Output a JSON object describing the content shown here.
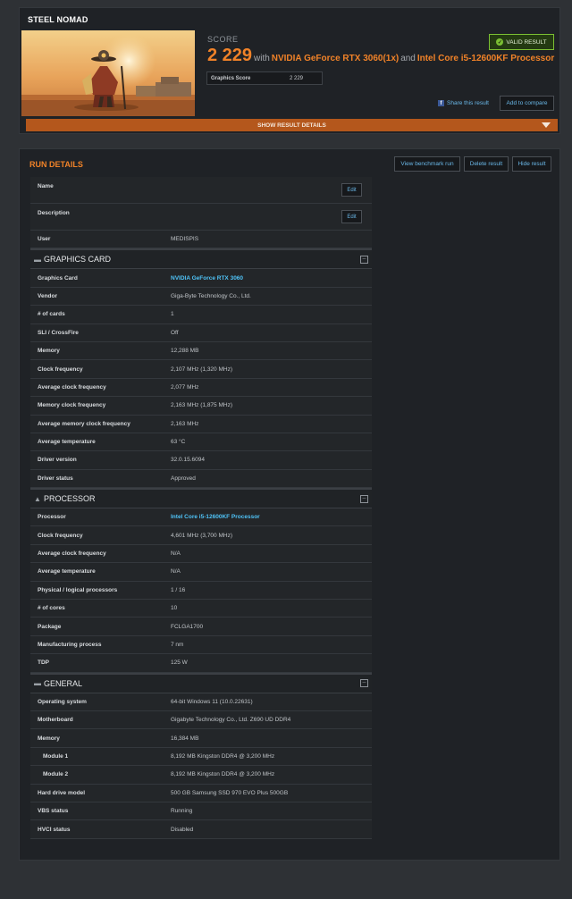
{
  "top": {
    "title": "STEEL NOMAD",
    "score_label": "SCORE",
    "score_value": "2 229",
    "with_text": "with",
    "gpu_text": "NVIDIA GeForce RTX 3060(1x)",
    "and_text": "and",
    "cpu_text": "Intel Core i5-12600KF Processor",
    "graphics_score_label": "Graphics Score",
    "graphics_score_value": "2 229",
    "valid_label": "VALID RESULT",
    "share_label": "Share this result",
    "compare_label": "Add to compare",
    "show_details_label": "SHOW RESULT DETAILS"
  },
  "run": {
    "title": "RUN DETAILS",
    "buttons": {
      "view": "View benchmark run",
      "delete": "Delete result",
      "hide": "Hide result"
    },
    "edit_label": "Edit",
    "name_label": "Name",
    "description_label": "Description",
    "user_label": "User",
    "user_value": "MEDISPIS"
  },
  "graphics": {
    "title": "GRAPHICS CARD",
    "rows": [
      {
        "label": "Graphics Card",
        "value": "NVIDIA GeForce RTX 3060"
      },
      {
        "label": "Vendor",
        "value": "Giga-Byte Technology Co., Ltd."
      },
      {
        "label": "# of cards",
        "value": "1"
      },
      {
        "label": "SLI / CrossFire",
        "value": "Off"
      },
      {
        "label": "Memory",
        "value": "12,288 MB"
      },
      {
        "label": "Clock frequency",
        "value": "2,107 MHz (1,320 MHz)"
      },
      {
        "label": "Average clock frequency",
        "value": "2,077 MHz"
      },
      {
        "label": "Memory clock frequency",
        "value": "2,163 MHz (1,875 MHz)"
      },
      {
        "label": "Average memory clock frequency",
        "value": "2,163 MHz"
      },
      {
        "label": "Average temperature",
        "value": "63 °C"
      },
      {
        "label": "Driver version",
        "value": "32.0.15.6094"
      },
      {
        "label": "Driver status",
        "value": "Approved"
      }
    ]
  },
  "processor": {
    "title": "PROCESSOR",
    "rows": [
      {
        "label": "Processor",
        "value": "Intel Core i5-12600KF Processor"
      },
      {
        "label": "Clock frequency",
        "value": "4,601 MHz (3,700 MHz)"
      },
      {
        "label": "Average clock frequency",
        "value": "N/A"
      },
      {
        "label": "Average temperature",
        "value": "N/A"
      },
      {
        "label": "Physical / logical processors",
        "value": "1 / 16"
      },
      {
        "label": "# of cores",
        "value": "10"
      },
      {
        "label": "Package",
        "value": "FCLGA1700"
      },
      {
        "label": "Manufacturing process",
        "value": "7 nm"
      },
      {
        "label": "TDP",
        "value": "125 W"
      }
    ]
  },
  "general": {
    "title": "GENERAL",
    "rows": [
      {
        "label": "Operating system",
        "value": "64-bit Windows 11 (10.0.22631)"
      },
      {
        "label": "Motherboard",
        "value": "Gigabyte Technology Co., Ltd. Z690 UD DDR4"
      },
      {
        "label": "Memory",
        "value": "16,384 MB"
      },
      {
        "label": "Module 1",
        "value": "8,192 MB Kingston DDR4 @ 3,200 MHz"
      },
      {
        "label": "Module 2",
        "value": "8,192 MB Kingston DDR4 @ 3,200 MHz"
      },
      {
        "label": "Hard drive model",
        "value": "500 GB Samsung SSD 970 EVO Plus 500GB"
      },
      {
        "label": "VBS status",
        "value": "Running"
      },
      {
        "label": "HVCI status",
        "value": "Disabled"
      }
    ]
  }
}
